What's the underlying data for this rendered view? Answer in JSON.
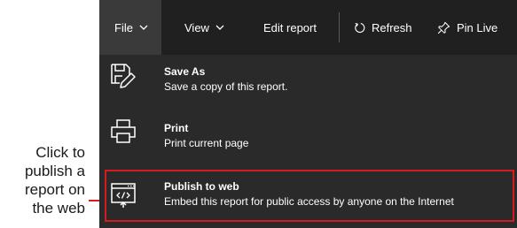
{
  "callout": {
    "lines": [
      "Click to",
      "publish a",
      "report on",
      "the web"
    ]
  },
  "menubar": {
    "file": "File",
    "view": "View",
    "edit_report": "Edit report",
    "refresh": "Refresh",
    "pin_live": "Pin Live"
  },
  "file_menu": {
    "items": [
      {
        "title": "Save As",
        "description": "Save a copy of this report.",
        "icon": "save-as-icon"
      },
      {
        "title": "Print",
        "description": "Print current page",
        "icon": "print-icon"
      },
      {
        "title": "Publish to web",
        "description": "Embed this report for public access by anyone on the Internet",
        "icon": "publish-to-web-icon"
      }
    ]
  },
  "colors": {
    "panel_background": "#2a2a2a",
    "menubar_background": "#202020",
    "active_tab": "#3a3a3a",
    "text": "#ffffff",
    "annotation_red": "#d71920"
  }
}
